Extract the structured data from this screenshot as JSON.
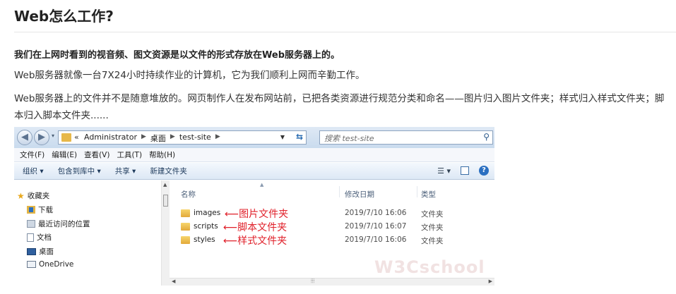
{
  "article": {
    "title": "Web怎么工作?",
    "lead": "我们在上网时看到的视音频、图文资源是以文件的形式存放在Web服务器上的。",
    "para1": "Web服务器就像一台7X24小时持续作业的计算机，它为我们顺利上网而辛勤工作。",
    "para2": "Web服务器上的文件并不是随意堆放的。网页制作人在发布网站前，已把各类资源进行规范分类和命名——图片归入图片文件夹；样式归入样式文件夹；脚本归入脚本文件夹......"
  },
  "explorer": {
    "address": {
      "overflow": "«",
      "crumbs": [
        "Administrator",
        "桌面",
        "test-site"
      ]
    },
    "search_placeholder": "搜索 test-site",
    "menu": [
      "文件(F)",
      "编辑(E)",
      "查看(V)",
      "工具(T)",
      "帮助(H)"
    ],
    "commands": [
      "组织 ▾",
      "包含到库中 ▾",
      "共享 ▾",
      "新建文件夹"
    ],
    "nav": {
      "favorites": "收藏夹",
      "downloads": "下载",
      "recent": "最近访问的位置",
      "documents": "文档",
      "desktop": "桌面",
      "onedrive": "OneDrive"
    },
    "columns": {
      "name": "名称",
      "date": "修改日期",
      "type": "类型"
    },
    "files": [
      {
        "name": "images",
        "note": "图片文件夹",
        "date": "2019/7/10 16:06",
        "type": "文件夹"
      },
      {
        "name": "scripts",
        "note": "脚本文件夹",
        "date": "2019/7/10 16:07",
        "type": "文件夹"
      },
      {
        "name": "styles",
        "note": "样式文件夹",
        "date": "2019/7/10 16:06",
        "type": "文件夹"
      }
    ],
    "watermark": "W3Cschool",
    "icons": {
      "folder": "folder-icon",
      "star": "star-icon",
      "search": "search-icon",
      "help": "help-icon"
    },
    "colors": {
      "annotation": "#e0202a",
      "folder": "#e2a93a"
    }
  }
}
